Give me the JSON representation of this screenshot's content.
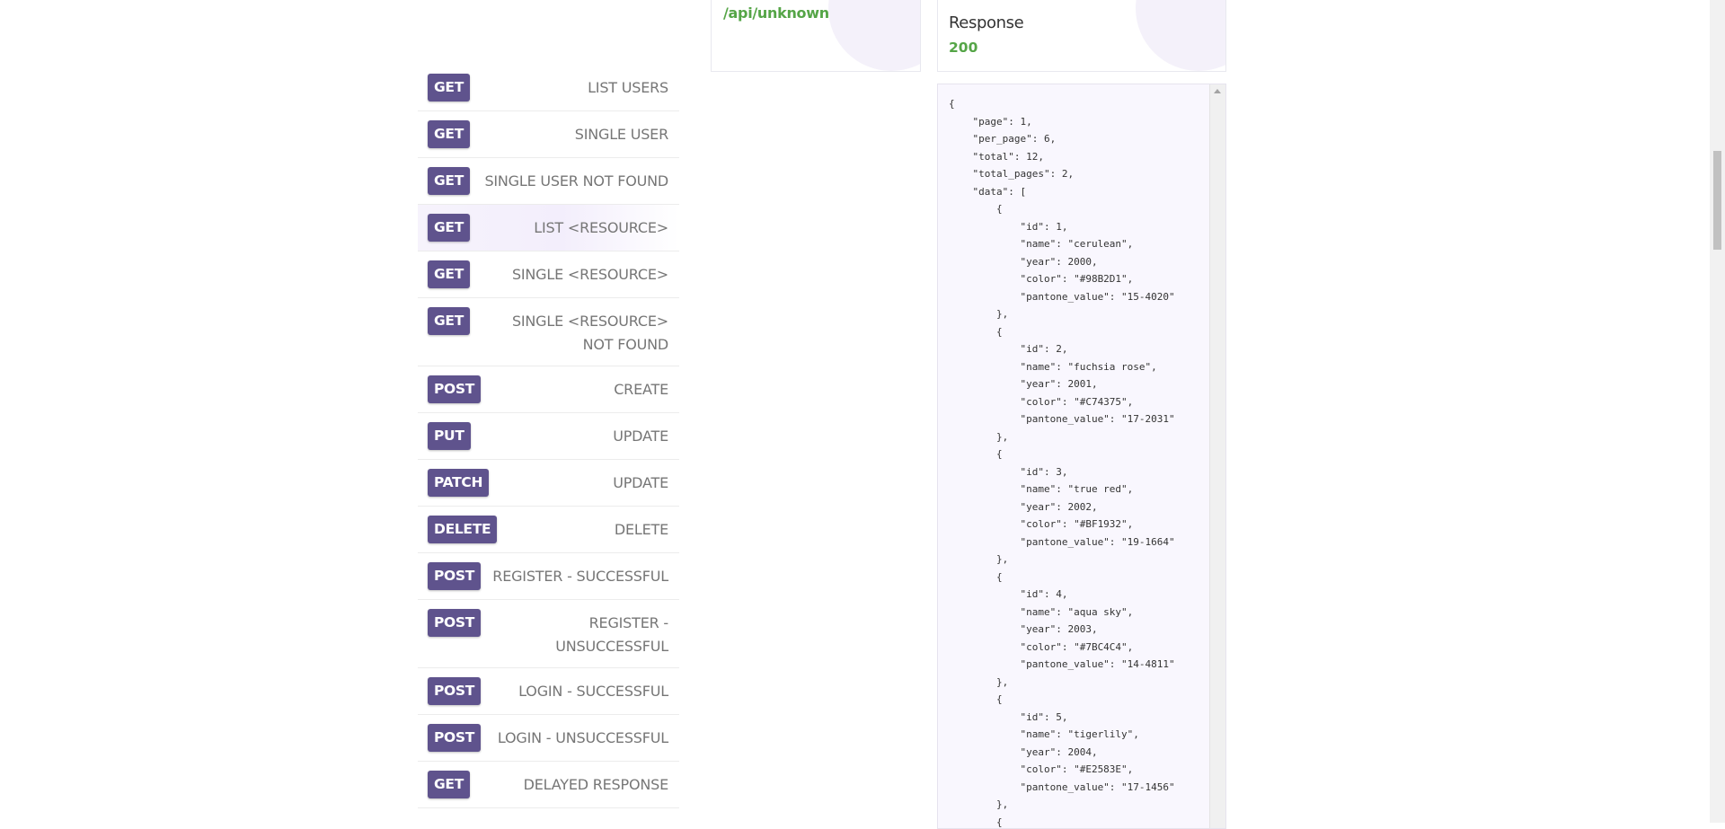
{
  "endpoints": [
    {
      "method": "GET",
      "label": "LIST USERS"
    },
    {
      "method": "GET",
      "label": "SINGLE USER"
    },
    {
      "method": "GET",
      "label": "SINGLE USER NOT FOUND"
    },
    {
      "method": "GET",
      "label": "LIST <RESOURCE>",
      "active": true
    },
    {
      "method": "GET",
      "label": "SINGLE <RESOURCE>"
    },
    {
      "method": "GET",
      "label": "SINGLE <RESOURCE> NOT FOUND"
    },
    {
      "method": "POST",
      "label": "CREATE"
    },
    {
      "method": "PUT",
      "label": "UPDATE"
    },
    {
      "method": "PATCH",
      "label": "UPDATE"
    },
    {
      "method": "DELETE",
      "label": "DELETE"
    },
    {
      "method": "POST",
      "label": "REGISTER - SUCCESSFUL"
    },
    {
      "method": "POST",
      "label": "REGISTER - UNSUCCESSFUL"
    },
    {
      "method": "POST",
      "label": "LOGIN - SUCCESSFUL"
    },
    {
      "method": "POST",
      "label": "LOGIN - UNSUCCESSFUL"
    },
    {
      "method": "GET",
      "label": "DELAYED RESPONSE"
    }
  ],
  "request": {
    "url": "/api/unknown"
  },
  "response": {
    "title": "Response",
    "status": "200",
    "body_lines": [
      "{",
      "    \"page\": 1,",
      "    \"per_page\": 6,",
      "    \"total\": 12,",
      "    \"total_pages\": 2,",
      "    \"data\": [",
      "        {",
      "            \"id\": 1,",
      "            \"name\": \"cerulean\",",
      "            \"year\": 2000,",
      "            \"color\": \"#98B2D1\",",
      "            \"pantone_value\": \"15-4020\"",
      "        },",
      "        {",
      "            \"id\": 2,",
      "            \"name\": \"fuchsia rose\",",
      "            \"year\": 2001,",
      "            \"color\": \"#C74375\",",
      "            \"pantone_value\": \"17-2031\"",
      "        },",
      "        {",
      "            \"id\": 3,",
      "            \"name\": \"true red\",",
      "            \"year\": 2002,",
      "            \"color\": \"#BF1932\",",
      "            \"pantone_value\": \"19-1664\"",
      "        },",
      "        {",
      "            \"id\": 4,",
      "            \"name\": \"aqua sky\",",
      "            \"year\": 2003,",
      "            \"color\": \"#7BC4C4\",",
      "            \"pantone_value\": \"14-4811\"",
      "        },",
      "        {",
      "            \"id\": 5,",
      "            \"name\": \"tigerlily\",",
      "            \"year\": 2004,",
      "            \"color\": \"#E2583E\",",
      "            \"pantone_value\": \"17-1456\"",
      "        },",
      "        {"
    ]
  },
  "colors": {
    "badge": "#5f538d",
    "success": "#55a547",
    "code_bg": "#f9f7fe"
  }
}
